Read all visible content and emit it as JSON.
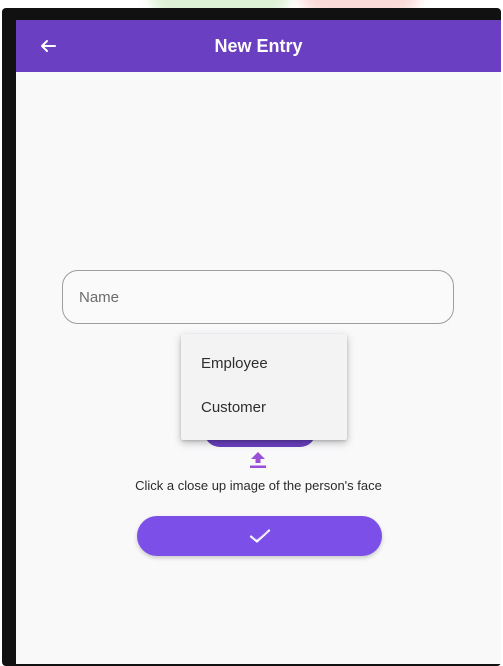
{
  "app_bar": {
    "title": "New Entry",
    "back_icon": "arrow-left-icon",
    "color": "#6a3fc2"
  },
  "form": {
    "name_field": {
      "placeholder": "Name",
      "value": ""
    },
    "type_dropdown": {
      "options": [
        "Employee",
        "Customer"
      ]
    },
    "upload_icon": "upload-arrow-icon",
    "instruction": "Click a close up image of the person's face",
    "submit_icon": "check-icon",
    "submit_color": "#7b4fe8"
  }
}
